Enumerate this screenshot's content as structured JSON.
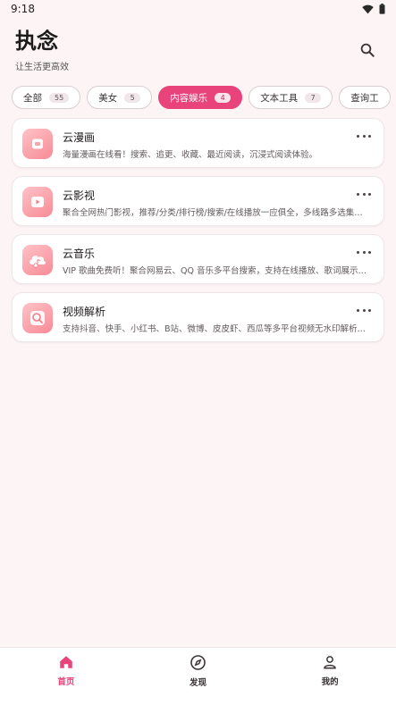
{
  "status_bar": {
    "time": "9:18"
  },
  "header": {
    "title": "执念",
    "subtitle": "让生活更高效"
  },
  "tabs": [
    {
      "label": "全部",
      "count": "55",
      "active": false
    },
    {
      "label": "美女",
      "count": "5",
      "active": false
    },
    {
      "label": "内容娱乐",
      "count": "4",
      "active": true
    },
    {
      "label": "文本工具",
      "count": "7",
      "active": false
    },
    {
      "label": "查询工",
      "count": "",
      "active": false
    }
  ],
  "items": [
    {
      "title": "云漫画",
      "desc": "海量漫画在线看！搜索、追更、收藏、最近阅读，沉浸式阅读体验。",
      "icon": "book-icon"
    },
    {
      "title": "云影视",
      "desc": "聚合全网热门影视，推荐/分类/排行榜/搜索/在线播放一应俱全，多线路多选集…",
      "icon": "video-play-icon"
    },
    {
      "title": "云音乐",
      "desc": "VIP 歌曲免费听！聚合网易云、QQ 音乐多平台搜索，支持在线播放、歌词展示…",
      "icon": "cloud-music-icon"
    },
    {
      "title": "视频解析",
      "desc": "支持抖音、快手、小红书、B站、微博、皮皮虾、西瓜等多平台视频无水印解析…",
      "icon": "magnifier-icon"
    }
  ],
  "bottom_nav": [
    {
      "label": "首页",
      "icon": "home-icon",
      "active": true
    },
    {
      "label": "发现",
      "icon": "compass-icon",
      "active": false
    },
    {
      "label": "我的",
      "icon": "user-icon",
      "active": false
    }
  ],
  "colors": {
    "accent": "#e8437a",
    "background": "#fdf4f6",
    "icon_gradient_start": "#ffc2c7",
    "icon_gradient_end": "#f78b96"
  }
}
